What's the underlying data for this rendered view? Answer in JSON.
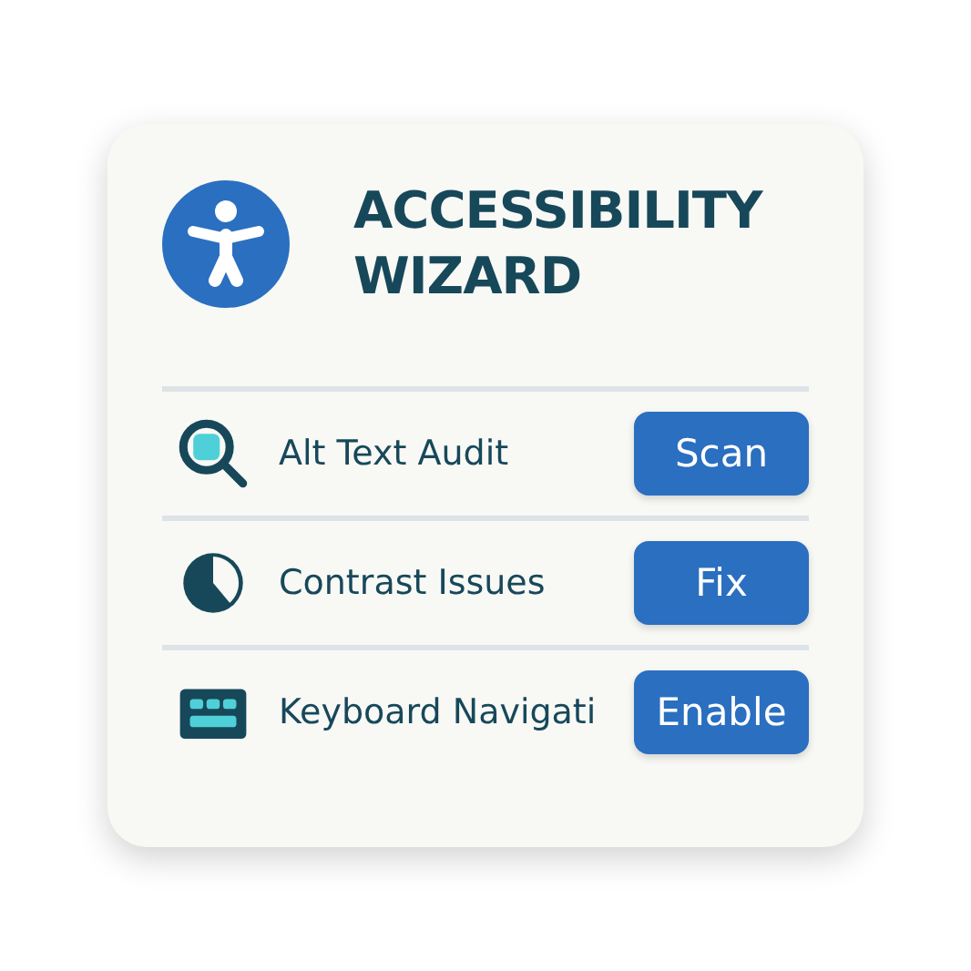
{
  "header": {
    "title_lines": [
      "ACCESSIBILITY",
      "WIZARD"
    ]
  },
  "rows": [
    {
      "kind": "magnifier",
      "label": "Alt Text Audit",
      "button": "Scan"
    },
    {
      "kind": "contrast",
      "label": "Contrast Issues",
      "button": "Fix"
    },
    {
      "kind": "keyboard",
      "label": "Keyboard Navigati",
      "button": "Enable"
    }
  ]
}
